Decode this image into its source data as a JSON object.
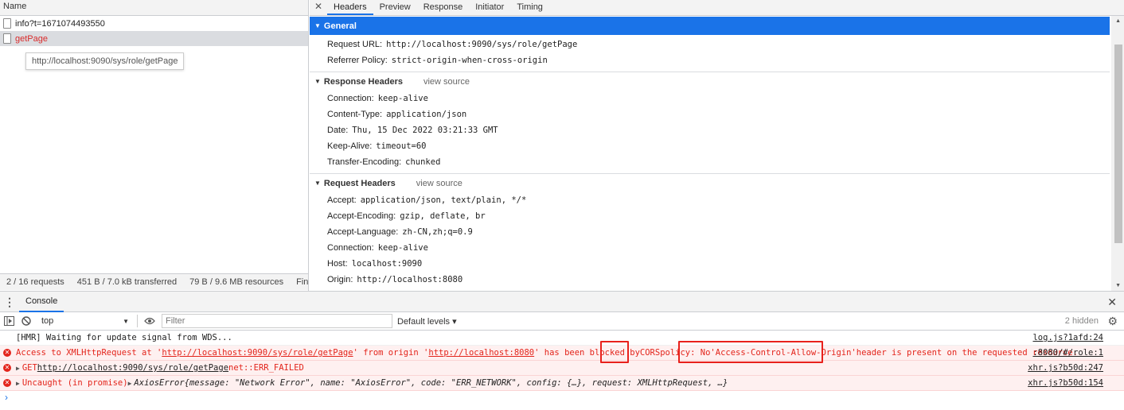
{
  "network": {
    "name_header": "Name",
    "requests": [
      {
        "name": "info?t=1671074493550",
        "error": false
      },
      {
        "name": "getPage",
        "error": true
      }
    ],
    "tooltip": "http://localhost:9090/sys/role/getPage",
    "status": {
      "requests": "2 / 16 requests",
      "transferred": "451 B / 7.0 kB transferred",
      "resources": "79 B / 9.6 MB resources",
      "finish": "Finis"
    }
  },
  "details": {
    "tabs": [
      "Headers",
      "Preview",
      "Response",
      "Initiator",
      "Timing"
    ],
    "active_tab": "Headers",
    "close_glyph": "✕",
    "general": {
      "title": "General",
      "rows": [
        {
          "k": "Request URL:",
          "v": "http://localhost:9090/sys/role/getPage"
        },
        {
          "k": "Referrer Policy:",
          "v": "strict-origin-when-cross-origin"
        }
      ]
    },
    "response_headers": {
      "title": "Response Headers",
      "view_source": "view source",
      "rows": [
        {
          "k": "Connection:",
          "v": "keep-alive"
        },
        {
          "k": "Content-Type:",
          "v": "application/json"
        },
        {
          "k": "Date:",
          "v": "Thu, 15 Dec 2022 03:21:33 GMT"
        },
        {
          "k": "Keep-Alive:",
          "v": "timeout=60"
        },
        {
          "k": "Transfer-Encoding:",
          "v": "chunked"
        }
      ]
    },
    "request_headers": {
      "title": "Request Headers",
      "view_source": "view source",
      "rows": [
        {
          "k": "Accept:",
          "v": "application/json, text/plain, */*"
        },
        {
          "k": "Accept-Encoding:",
          "v": "gzip, deflate, br"
        },
        {
          "k": "Accept-Language:",
          "v": "zh-CN,zh;q=0.9"
        },
        {
          "k": "Connection:",
          "v": "keep-alive"
        },
        {
          "k": "Host:",
          "v": "localhost:9090"
        },
        {
          "k": "Origin:",
          "v": "http://localhost:8080"
        }
      ]
    }
  },
  "console": {
    "tab_label": "Console",
    "context": "top",
    "filter_placeholder": "Filter",
    "levels": "Default levels ▾",
    "hidden": "2 hidden",
    "logs": {
      "hmr": {
        "text": "[HMR] Waiting for update signal from WDS...",
        "src": "log.js?1afd:24"
      },
      "cors": {
        "p1": "Access to XMLHttpRequest at '",
        "url1": "http://localhost:9090/sys/role/getPage",
        "p2": "' from origin '",
        "url2": "http://localhost:8080",
        "p3": "' has been blocked by ",
        "cors": "CORS",
        "p4": " policy: No ",
        "header": "'Access-Control-Allow-Origin'",
        "p5": " header is present on the requested resource.",
        "src": ":8080/#/role:1"
      },
      "get": {
        "method": "GET ",
        "url": "http://localhost:9090/sys/role/getPage",
        "msg": " net::ERR_FAILED",
        "src": "xhr.js?b50d:247"
      },
      "uncaught": {
        "p1": "Uncaught (in promise) ",
        "err": "AxiosError",
        "obj": " {message: \"Network Error\", name: \"AxiosError\", code: \"ERR_NETWORK\", config: {…}, request: XMLHttpRequest, …}",
        "src": "xhr.js?b50d:154"
      }
    },
    "prompt": "›"
  }
}
